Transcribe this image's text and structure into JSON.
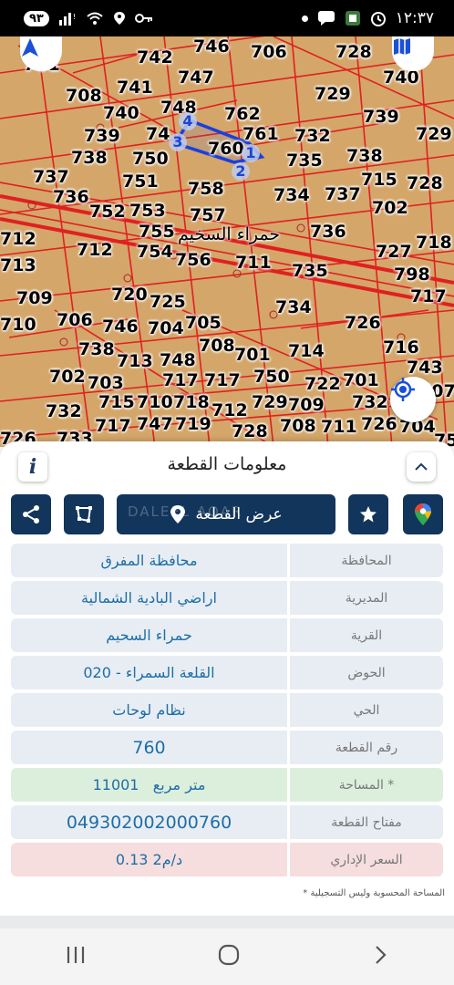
{
  "status": {
    "battery": "٩٣",
    "time": "١٢:٣٧"
  },
  "map": {
    "village_label": "حمراء السخيم",
    "parcel_numbers": [
      {
        "t": "701"
      },
      {
        "t": "742"
      },
      {
        "t": "746"
      },
      {
        "t": "706"
      },
      {
        "t": "728"
      },
      {
        "t": "740"
      },
      {
        "t": "747"
      },
      {
        "t": "741"
      },
      {
        "t": "708"
      },
      {
        "t": "729"
      },
      {
        "t": "740"
      },
      {
        "t": "748"
      },
      {
        "t": "762"
      },
      {
        "t": "739"
      },
      {
        "t": "739"
      },
      {
        "t": "74"
      },
      {
        "t": "761"
      },
      {
        "t": "732"
      },
      {
        "t": "729"
      },
      {
        "t": "760"
      },
      {
        "t": "738"
      },
      {
        "t": "750"
      },
      {
        "t": "738"
      },
      {
        "t": "735"
      },
      {
        "t": "737"
      },
      {
        "t": "751"
      },
      {
        "t": "715"
      },
      {
        "t": "728"
      },
      {
        "t": "736"
      },
      {
        "t": "758"
      },
      {
        "t": "734"
      },
      {
        "t": "737"
      },
      {
        "t": "702"
      },
      {
        "t": "752"
      },
      {
        "t": "753"
      },
      {
        "t": "757"
      },
      {
        "t": "755"
      },
      {
        "t": "736"
      },
      {
        "t": "712"
      },
      {
        "t": "727"
      },
      {
        "t": "718"
      },
      {
        "t": "712"
      },
      {
        "t": "754"
      },
      {
        "t": "756"
      },
      {
        "t": "711"
      },
      {
        "t": "713"
      },
      {
        "t": "735"
      },
      {
        "t": "798"
      },
      {
        "t": "709"
      },
      {
        "t": "720"
      },
      {
        "t": "725"
      },
      {
        "t": "717"
      },
      {
        "t": "734"
      },
      {
        "t": "710"
      },
      {
        "t": "706"
      },
      {
        "t": "746"
      },
      {
        "t": "704"
      },
      {
        "t": "705"
      },
      {
        "t": "726"
      },
      {
        "t": "738"
      },
      {
        "t": "708"
      },
      {
        "t": "701"
      },
      {
        "t": "714"
      },
      {
        "t": "716"
      },
      {
        "t": "713"
      },
      {
        "t": "748"
      },
      {
        "t": "743"
      },
      {
        "t": "702"
      },
      {
        "t": "703"
      },
      {
        "t": "717"
      },
      {
        "t": "717"
      },
      {
        "t": "750"
      },
      {
        "t": "722"
      },
      {
        "t": "701"
      },
      {
        "t": "707"
      },
      {
        "t": "715"
      },
      {
        "t": "710"
      },
      {
        "t": "718"
      },
      {
        "t": "712"
      },
      {
        "t": "729"
      },
      {
        "t": "709"
      },
      {
        "t": "732"
      },
      {
        "t": "732"
      },
      {
        "t": "717"
      },
      {
        "t": "747"
      },
      {
        "t": "719"
      },
      {
        "t": "728"
      },
      {
        "t": "708"
      },
      {
        "t": "711"
      },
      {
        "t": "726"
      },
      {
        "t": "704"
      },
      {
        "t": "726"
      },
      {
        "t": "733"
      },
      {
        "t": "75"
      }
    ],
    "vertices": [
      "4",
      "3",
      "1",
      "2"
    ],
    "colors": {
      "land": "#d4a66a",
      "lines": "#e02020",
      "selection": "#1a3fe0"
    }
  },
  "sheet": {
    "title": "معلومات القطعة",
    "info_icon": "i",
    "show_parcel_label": "عرض القطعة",
    "watermark": "DALEEL AQAR",
    "rows": [
      {
        "label": "المحافظة",
        "value": "محافظة المفرق"
      },
      {
        "label": "المديرية",
        "value": "اراضي البادية الشمالية"
      },
      {
        "label": "القرية",
        "value": "حمراء السحيم"
      },
      {
        "label": "الحوض",
        "value": "القلعة السمراء - 020"
      },
      {
        "label": "الحي",
        "value": "نظام لوحات"
      },
      {
        "label": "رقم القطعة",
        "value": "760"
      },
      {
        "label": "المساحة *",
        "value": "11001   متر مربع"
      },
      {
        "label": "مفتاح القطعة",
        "value": "049302002000760"
      },
      {
        "label": "السعر الإداري",
        "value": "0.13 د/م2"
      }
    ],
    "footnote": "* المساحة المحسوبة وليس التسجيلية"
  },
  "nav": {
    "recent": "recent-apps-icon",
    "home": "home-icon",
    "back": "back-icon"
  }
}
